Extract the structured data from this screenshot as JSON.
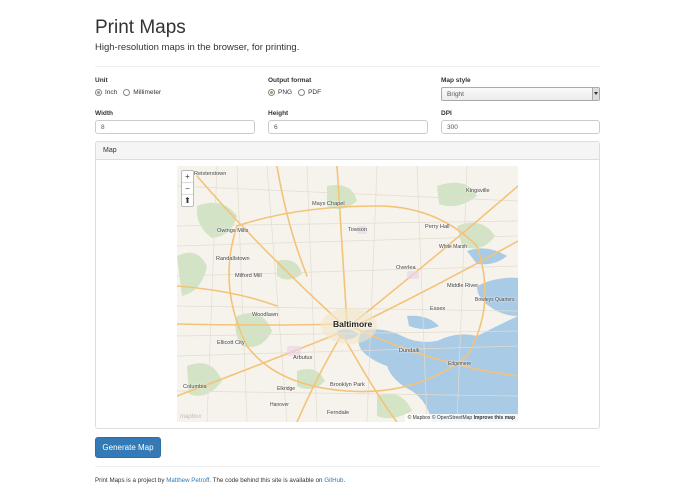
{
  "header": {
    "title": "Print Maps",
    "subtitle": "High-resolution maps in the browser, for printing."
  },
  "form": {
    "unit": {
      "label": "Unit",
      "options": [
        "Inch",
        "Millimeter"
      ],
      "selected": "Inch"
    },
    "output_format": {
      "label": "Output format",
      "options": [
        "PNG",
        "PDF"
      ],
      "selected": "PNG"
    },
    "map_style": {
      "label": "Map style",
      "value": "Bright"
    },
    "width": {
      "label": "Width",
      "value": "8"
    },
    "height": {
      "label": "Height",
      "value": "6"
    },
    "dpi": {
      "label": "DPI",
      "value": "300"
    }
  },
  "map_panel": {
    "heading": "Map",
    "zoom_in": "+",
    "zoom_out": "−",
    "compass": "⬆",
    "attribution": {
      "mapbox": "© Mapbox",
      "osm": "© OpenStreetMap",
      "improve": "Improve this map"
    },
    "logo": "mapbox",
    "places": {
      "reisterstown": "Reisterstown",
      "mays_chapel": "Mays Chapel",
      "kingsville": "Kingsville",
      "owings_mills": "Owings Mills",
      "towson": "Towson",
      "perry_hall": "Perry Hall",
      "white_marsh": "White Marsh",
      "randallstown": "Randallstown",
      "overlea": "Overlea",
      "milford_mill": "Milford Mill",
      "middle_river": "Middle River",
      "bowleys_quarters": "Bowleys Quarters",
      "essex": "Essex",
      "woodlawn": "Woodlawn",
      "baltimore": "Baltimore",
      "ellicott_city": "Ellicott City",
      "dundalk": "Dundalk",
      "arbutus": "Arbutus",
      "edgemere": "Edgemere",
      "columbia": "Columbia",
      "elkridge": "Elkridge",
      "brooklyn_park": "Brooklyn Park",
      "hanover": "Hanover",
      "ferndale": "Ferndale"
    }
  },
  "actions": {
    "generate_label": "Generate Map"
  },
  "footer": {
    "text1": "Print Maps is a project by ",
    "author_link": "Matthew Petroff",
    "text2": ". The code behind this site is available on ",
    "github_link": "GitHub",
    "text3": "."
  },
  "colors": {
    "primary": "#337ab7",
    "water": "#a9cbe6",
    "park": "#cfe3c1",
    "road_major": "#f4c37a",
    "land": "#f6f3ec"
  }
}
